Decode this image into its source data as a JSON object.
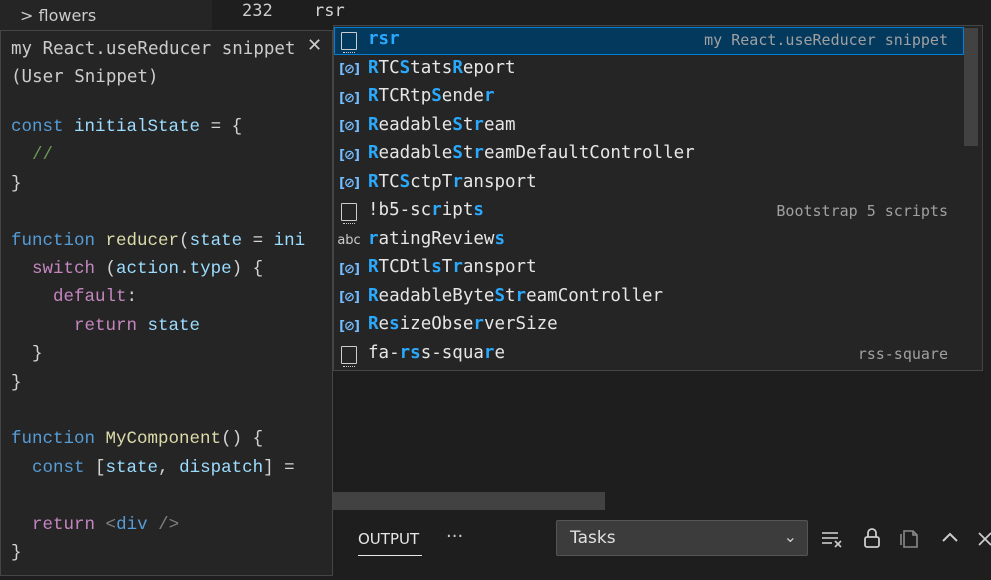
{
  "explorer": {
    "item": "flowers",
    "chevron": ">"
  },
  "editor": {
    "line_number": "232",
    "line_text": "rsr"
  },
  "snippet_detail": {
    "title": "my React.useReducer snippet (User Snippet)",
    "close": "✕"
  },
  "suggestions": [
    {
      "label": "rsr",
      "kind": "snippet",
      "detail": "my React.useReducer snippet",
      "selected": true
    },
    {
      "label": "RTCStatsReport",
      "kind": "variable",
      "detail": ""
    },
    {
      "label": "RTCRtpSender",
      "kind": "variable",
      "detail": ""
    },
    {
      "label": "ReadableStream",
      "kind": "variable",
      "detail": ""
    },
    {
      "label": "ReadableStreamDefaultController",
      "kind": "variable",
      "detail": ""
    },
    {
      "label": "RTCSctpTransport",
      "kind": "variable",
      "detail": ""
    },
    {
      "label": "!b5-scripts",
      "kind": "snippet",
      "detail": "Bootstrap 5 scripts"
    },
    {
      "label": "ratingReviews",
      "kind": "text",
      "detail": ""
    },
    {
      "label": "RTCDtlsTransport",
      "kind": "variable",
      "detail": ""
    },
    {
      "label": "ReadableByteStreamController",
      "kind": "variable",
      "detail": ""
    },
    {
      "label": "ResizeObserverSize",
      "kind": "variable",
      "detail": ""
    },
    {
      "label": "fa-rss-square",
      "kind": "snippet",
      "detail": "rss-square"
    }
  ],
  "icons": {
    "snippet": "snippet-icon",
    "variable": "variable-icon",
    "text": "text-icon",
    "text_glyph": "abc",
    "variable_glyph": "[⊘]"
  },
  "panel": {
    "tab": "OUTPUT",
    "more": "···",
    "select_value": "Tasks",
    "select_chevron": "⌄"
  }
}
